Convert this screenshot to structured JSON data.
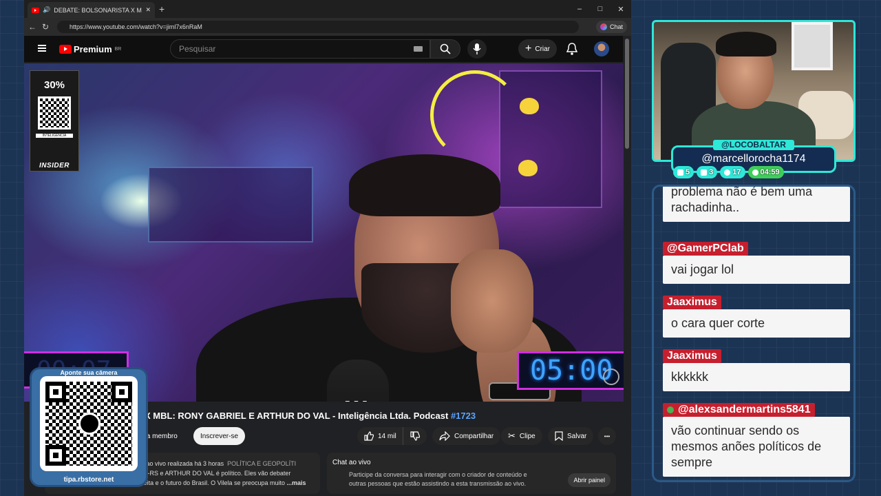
{
  "browser": {
    "tab_title": "DEBATE: BOLSONARISTA X MI",
    "new_tab": "+",
    "win_min": "–",
    "win_max": "□",
    "win_close": "✕",
    "url": "https://www.youtube.com/watch?v=jiml7x6nRaM",
    "chat_label": "Chat"
  },
  "youtube": {
    "logo": "Premium",
    "region": "BR",
    "search_placeholder": "Pesquisar",
    "criar": "Criar",
    "video_title_main": "X MBL: RONY GABRIEL E ARTHUR DO VAL - Inteligência Ltda. Podcast ",
    "video_title_tag": "#1723",
    "seja_membro": "eja membro",
    "subscribe": "Inscrever-se",
    "likes": "14 mil",
    "share": "Compartilhar",
    "clip": "Clipe",
    "save": "Salvar",
    "more": "•••",
    "desc_line1": "o ao vivo realizada há 3 horas",
    "desc_category": "POLÍTICA E GEOPOLÍTI",
    "desc_line2": "im-RS e ARTHUR DO VAL é político. Eles vão debater",
    "desc_line3": "sobre Bolsonaro, a política da direita e o futuro do Brasil. O Vilela se preocupa muito",
    "desc_more": "...mais",
    "livechat_title": "Chat ao vivo",
    "livechat_text": "Participe da conversa para interagir com o criador de conteúdo e outras pessoas que estão assistindo a esta transmissão ao vivo.",
    "livechat_button": "Abrir painel"
  },
  "video": {
    "ad_pct": "30%",
    "ad_label": "INTELIGÊNCIA",
    "ad_brand": "INSIDER",
    "timer_left": "00:07",
    "timer_right": "05:00"
  },
  "qr_overlay": {
    "caption": "Aponte sua câmera",
    "url": "tipa.rbstore.net"
  },
  "stream": {
    "handle": "@LOCOBALTAR",
    "username": "@marcellorocha1174",
    "stats": [
      {
        "icon": "chat-icon",
        "value": "5"
      },
      {
        "icon": "play-icon",
        "value": "3"
      },
      {
        "icon": "link-icon",
        "value": "17"
      },
      {
        "icon": "whatsapp-icon",
        "value": "04:59"
      }
    ]
  },
  "chat": {
    "messages": [
      {
        "author": "",
        "text": "problema não é bem uma rachadinha.."
      },
      {
        "author": "@GamerPClab",
        "text": "vai jogar lol"
      },
      {
        "author": "Jaaximus",
        "text": "o cara quer corte"
      },
      {
        "author": "Jaaximus",
        "text": "kkkkkk"
      },
      {
        "author": "@alexsandermartins5841",
        "text": "vão continuar sendo os mesmos anões políticos de sempre"
      }
    ]
  },
  "colors": {
    "accent_cyan": "#2ee8d8",
    "chat_author_bg": "#c61f2e",
    "timer_border": "#d12fe0",
    "yt_red": "#ff0000"
  }
}
